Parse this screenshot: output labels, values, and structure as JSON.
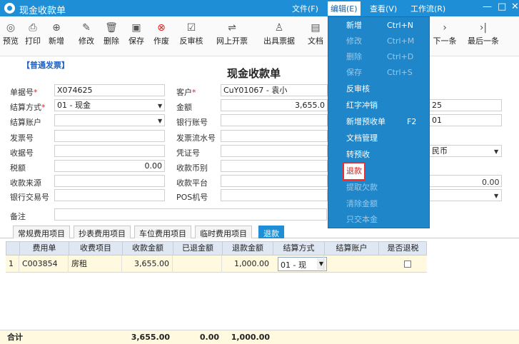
{
  "window": {
    "title": "现金收款单",
    "menus": [
      "文件(F)",
      "编辑(E)",
      "查看(V)",
      "工作流(R)"
    ],
    "controls": [
      "—",
      "□",
      "✕"
    ]
  },
  "toolbar": [
    {
      "label": "预览",
      "icon": "◎"
    },
    {
      "label": "打印",
      "icon": "⎙"
    },
    {
      "label": "新增",
      "icon": "⊕"
    },
    {
      "label": "修改",
      "icon": "✎"
    },
    {
      "label": "删除",
      "icon": "🗑"
    },
    {
      "label": "保存",
      "icon": "▣"
    },
    {
      "label": "作废",
      "icon": "⊗"
    },
    {
      "label": "反审核",
      "icon": "☑"
    },
    {
      "label": "网上开票",
      "icon": "⇌"
    },
    {
      "label": "出具票据",
      "icon": "♙"
    },
    {
      "label": "文档",
      "icon": "▤"
    },
    {
      "label": "下一条",
      "icon": "›"
    },
    {
      "label": "最后一条",
      "icon": "›|"
    }
  ],
  "form": {
    "tag": "【普通发票】",
    "title": "现金收款单",
    "doc_no_label": "单据号",
    "doc_no": "X074625",
    "settle_label": "结算方式",
    "settle_value": "01 - 现金",
    "settle_acct_label": "结算账户",
    "invoice_no_label": "发票号",
    "receipt_no_label": "收据号",
    "tax_label": "税额",
    "tax_value": "0.00",
    "source_label": "收款来源",
    "bank_txn_label": "银行交易号",
    "remark_label": "备注",
    "customer_label": "客户",
    "customer_value": "CuY01067 - 袁小",
    "amount_label": "金额",
    "amount_value": "3,655.0",
    "bank_acct_label": "银行账号",
    "invoice_serial_label": "发票流水号",
    "voucher_label": "凭证号",
    "currency_label": "收款币别",
    "platform_label": "收款平台",
    "pos_label": "POS机号",
    "right_partial": [
      "25",
      "01",
      "民币",
      "0.00"
    ],
    "required_mark": "*"
  },
  "tabs": [
    "常规费用项目",
    "抄表费用项目",
    "车位费用项目",
    "临时费用项目",
    "退款"
  ],
  "grid": {
    "headers": [
      "费用单",
      "收费项目",
      "收款金额",
      "已退金额",
      "退款金额",
      "结算方式",
      "结算账户",
      "是否退税"
    ],
    "row": {
      "index": "1",
      "bill": "C003854",
      "item": "房租",
      "received": "3,655.00",
      "refunded": "",
      "refund": "1,000.00",
      "settle": "01 - 现",
      "account": ""
    },
    "totals": {
      "label": "合计",
      "received": "3,655.00",
      "refunded": "0.00",
      "refund": "1,000.00"
    }
  },
  "edit_menu": [
    {
      "label": "新增",
      "shortcut": "Ctrl+N",
      "enabled": true
    },
    {
      "label": "修改",
      "shortcut": "Ctrl+M",
      "enabled": false
    },
    {
      "label": "删除",
      "shortcut": "Ctrl+D",
      "enabled": false
    },
    {
      "label": "保存",
      "shortcut": "Ctrl+S",
      "enabled": false
    },
    {
      "label": "反审核",
      "shortcut": "",
      "enabled": true
    },
    {
      "label": "红字冲销",
      "shortcut": "",
      "enabled": true
    },
    {
      "label": "新增预收单",
      "shortcut": "F2",
      "enabled": true
    },
    {
      "label": "文档管理",
      "shortcut": "",
      "enabled": true
    },
    {
      "label": "转预收",
      "shortcut": "",
      "enabled": true
    },
    {
      "label": "退款",
      "shortcut": "",
      "enabled": true
    },
    {
      "label": "提取欠款",
      "shortcut": "",
      "enabled": false
    },
    {
      "label": "清除金额",
      "shortcut": "",
      "enabled": false
    },
    {
      "label": "只交本金",
      "shortcut": "",
      "enabled": false
    }
  ],
  "colors": {
    "accent": "#1e8fd6",
    "highlight_border": "#e83030",
    "row_bg": "#fff9df"
  }
}
